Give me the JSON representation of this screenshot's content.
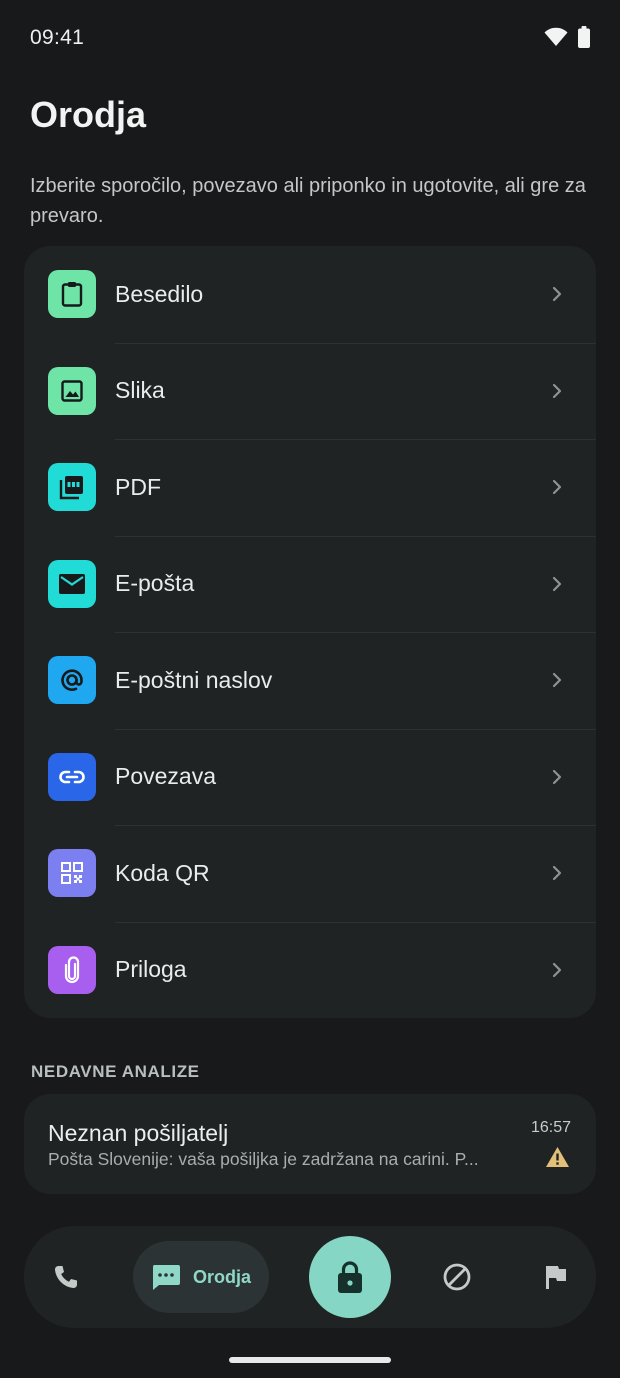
{
  "status_bar": {
    "time": "09:41"
  },
  "header": {
    "title": "Orodja",
    "subtitle": "Izberite sporočilo, povezavo ali priponko in ugotovite, ali gre za prevaro."
  },
  "tools": [
    {
      "label": "Besedilo",
      "icon": "clipboard-icon",
      "color": "#6ee4a6"
    },
    {
      "label": "Slika",
      "icon": "image-icon",
      "color": "#6ee4a6"
    },
    {
      "label": "PDF",
      "icon": "pdf-icon",
      "color": "#21dcd6"
    },
    {
      "label": "E-pošta",
      "icon": "mail-icon",
      "color": "#21dcd6"
    },
    {
      "label": "E-poštni naslov",
      "icon": "at-sign-icon",
      "color": "#1fa8f0"
    },
    {
      "label": "Povezava",
      "icon": "link-icon",
      "color": "#2a66e8"
    },
    {
      "label": "Koda QR",
      "icon": "qr-code-icon",
      "color": "#7c7ff0"
    },
    {
      "label": "Priloga",
      "icon": "paperclip-icon",
      "color": "#a85ff0"
    }
  ],
  "recent": {
    "section_label": "NEDAVNE ANALIZE",
    "items": [
      {
        "sender": "Neznan pošiljatelj",
        "preview": "Pošta Slovenije: vaša pošiljka je zadržana na carini. P...",
        "time": "16:57",
        "status_icon": "warning-icon",
        "status_color": "#e3c07a"
      }
    ]
  },
  "bottom_nav": {
    "active_label": "Orodja",
    "accent": "#85d6c4",
    "items": [
      "phone-icon",
      "chat-icon",
      "lock-icon",
      "block-icon",
      "flag-icon"
    ]
  }
}
